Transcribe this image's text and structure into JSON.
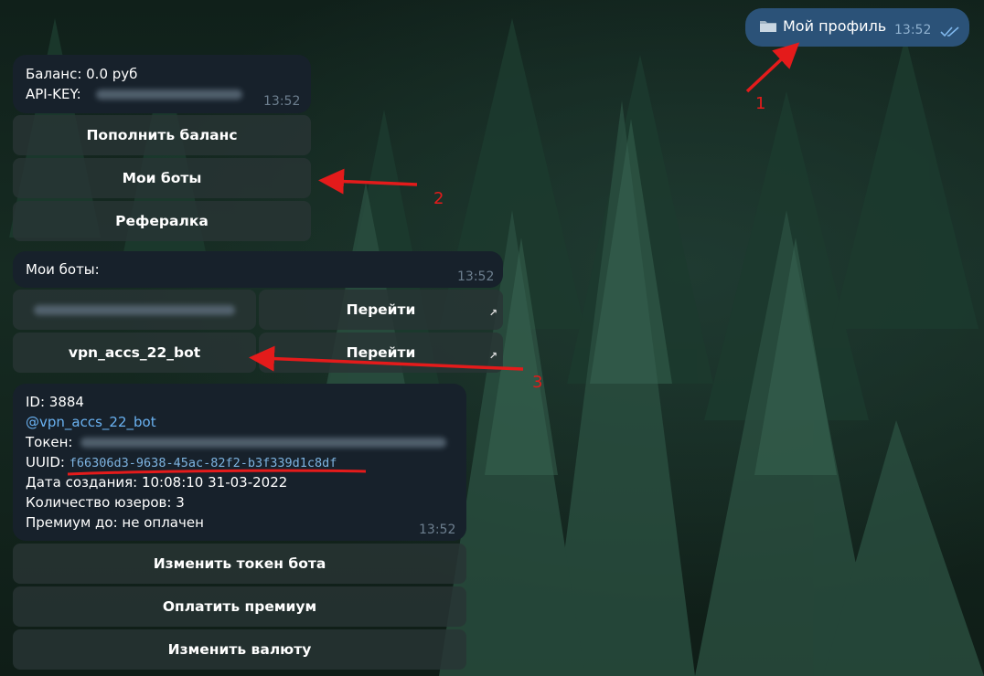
{
  "outgoing": {
    "icon": "folder-icon",
    "text": "Мой профиль",
    "time": "13:52",
    "status": "read-checkmarks"
  },
  "profile_message": {
    "balance": "Баланс: 0.0 руб",
    "api_key_label": "API-KEY:",
    "time": "13:52",
    "buttons": [
      "Пополнить баланс",
      "Мои боты",
      "Рефералка"
    ]
  },
  "bots_message": {
    "title": "Мои боты:",
    "time": "13:52",
    "rows": [
      {
        "bot": "",
        "action": "Перейти"
      },
      {
        "bot": "vpn_accs_22_bot",
        "action": "Перейти"
      }
    ]
  },
  "bot_info_message": {
    "id": "ID: 3884",
    "username": "@vpn_accs_22_bot",
    "token_label": "Токен:",
    "uuid_label": "UUID:",
    "uuid": "f66306d3-9638-45ac-82f2-b3f339d1c8df",
    "created": "Дата создания: 10:08:10 31-03-2022",
    "users": "Количество юзеров: 3",
    "premium": "Премиум до: не оплачен",
    "time": "13:52",
    "buttons": [
      "Изменить токен бота",
      "Оплатить премиум",
      "Изменить валюту"
    ]
  },
  "annotations": [
    "1",
    "2",
    "3"
  ],
  "colors": {
    "bubble_bg": "#17212b",
    "outgoing_bg": "#2b5278",
    "link": "#6ab2f2",
    "annotation": "#e41b1b"
  }
}
